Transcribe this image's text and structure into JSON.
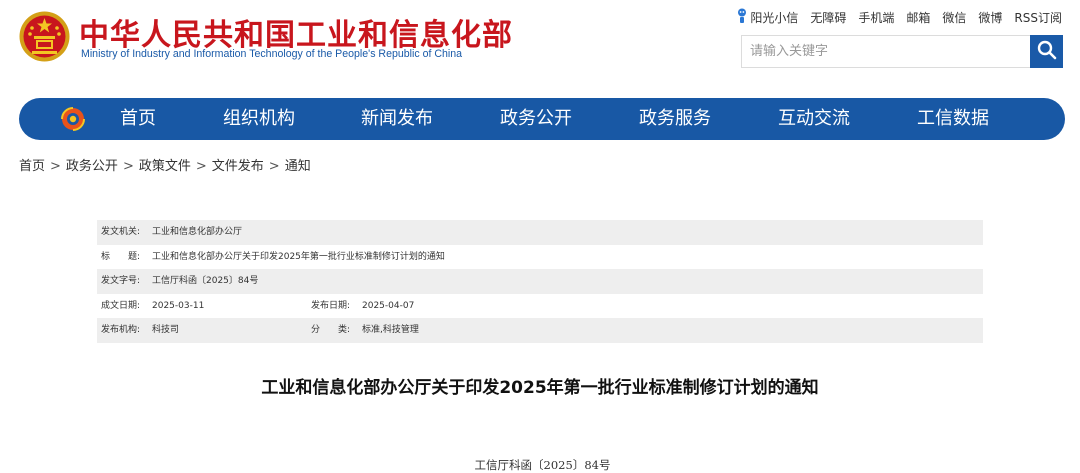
{
  "header": {
    "title_cn": "中华人民共和国工业和信息化部",
    "title_en": "Ministry of Industry and Information Technology of the People's Republic of China",
    "toplinks": [
      "阳光小信",
      "无障碍",
      "手机端",
      "邮箱",
      "微信",
      "微博",
      "RSS订阅"
    ],
    "search_placeholder": "请输入关键字"
  },
  "nav": {
    "items": [
      "首页",
      "组织机构",
      "新闻发布",
      "政务公开",
      "政务服务",
      "互动交流",
      "工信数据"
    ]
  },
  "breadcrumb": [
    "首页",
    "政务公开",
    "政策文件",
    "文件发布",
    "通知"
  ],
  "breadcrumb_sep": ">",
  "info": {
    "issuer_label": "发文机关:",
    "issuer": "工业和信息化部办公厅",
    "title_label": "标　　题:",
    "title": "工业和信息化部办公厅关于印发2025年第一批行业标准制修订计划的通知",
    "docno_label": "发文字号:",
    "docno": "工信厅科函〔2025〕84号",
    "written_label": "成文日期:",
    "written": "2025-03-11",
    "published_label": "发布日期:",
    "published": "2025-04-07",
    "org_label": "发布机构:",
    "org": "科技司",
    "category_label": "分　　类:",
    "category": "标准,科技管理"
  },
  "article": {
    "title": "工业和信息化部办公厅关于印发2025年第一批行业标准制修订计划的通知",
    "doc_number": "工信厅科函〔2025〕84号"
  },
  "colors": {
    "brand_red": "#c8161d",
    "brand_blue": "#1858a5"
  }
}
